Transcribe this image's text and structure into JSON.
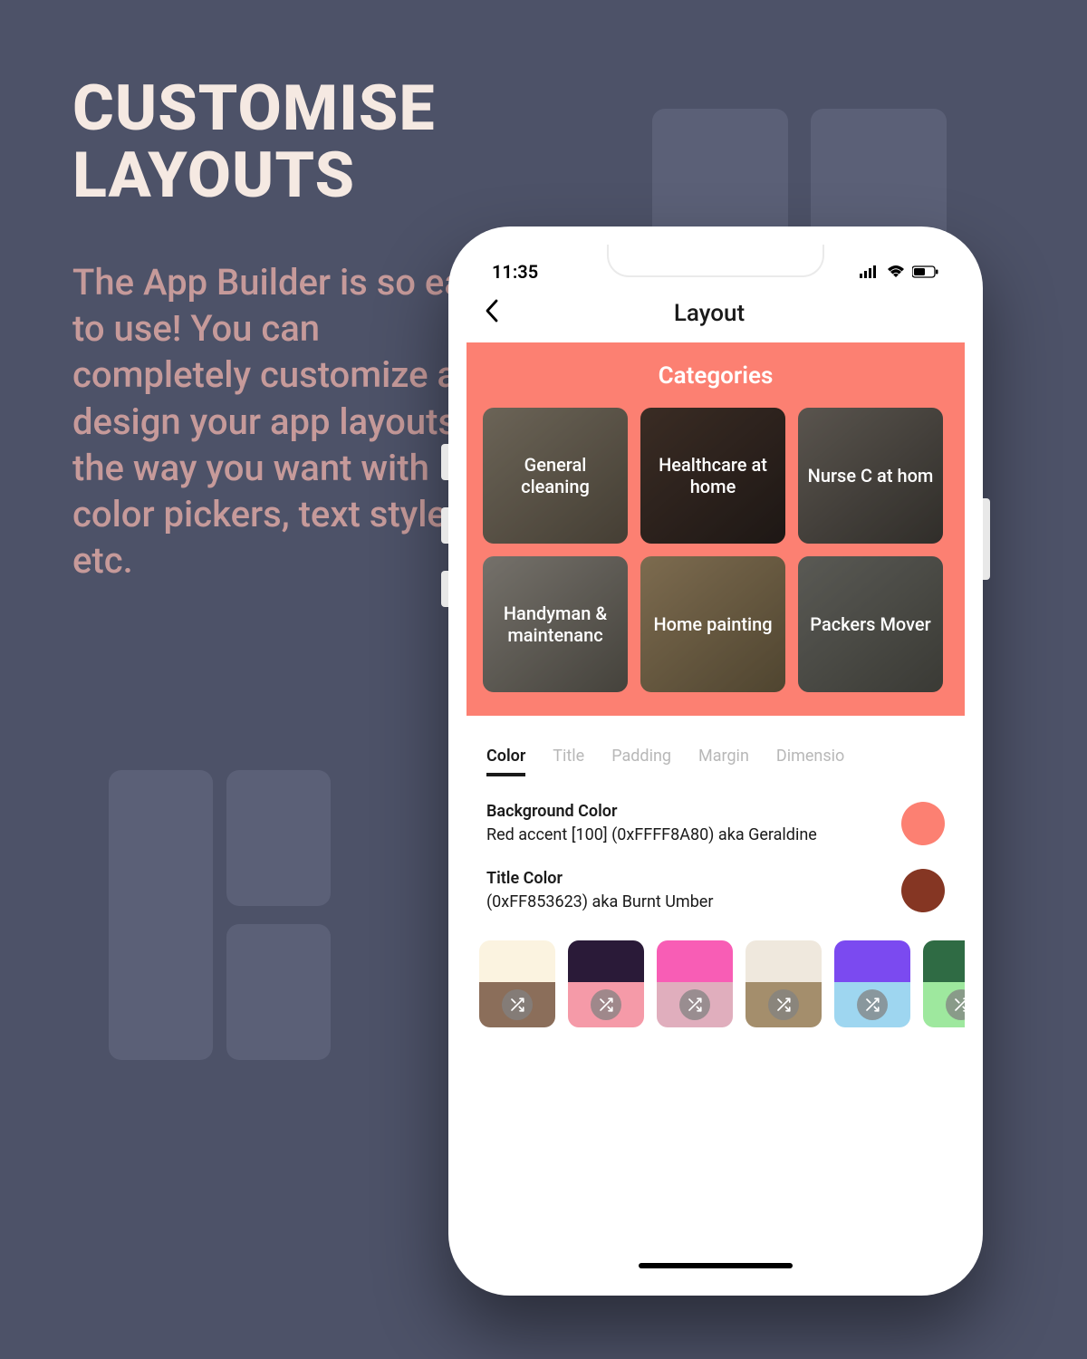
{
  "hero": {
    "title_line1": "CUSTOMISE",
    "title_line2": "LAYOUTS",
    "body": "The App Builder is so easy to use! You can completely customize and design your app layouts the way you want with color pickers, text styles, etc."
  },
  "status": {
    "time": "11:35"
  },
  "nav": {
    "title": "Layout"
  },
  "panel": {
    "title": "Categories",
    "categories": [
      {
        "label": "General cleaning"
      },
      {
        "label": "Healthcare at home"
      },
      {
        "label": "Nurse C at hom"
      },
      {
        "label": "Handyman & maintenanc"
      },
      {
        "label": "Home painting"
      },
      {
        "label": "Packers Mover"
      }
    ]
  },
  "tabs": {
    "active": 0,
    "items": [
      {
        "label": "Color"
      },
      {
        "label": "Title"
      },
      {
        "label": "Padding"
      },
      {
        "label": "Margin"
      },
      {
        "label": "Dimensio"
      }
    ]
  },
  "color_props": [
    {
      "name": "Background Color",
      "value": "Red accent [100] (0xFFFF8A80) aka Geraldine",
      "hex": "#fc8072"
    },
    {
      "name": "Title Color",
      "value": "(0xFF853623) aka Burnt Umber",
      "hex": "#853623"
    }
  ],
  "palettes": [
    {
      "top": "#fbf3e0",
      "bot": "#8b6e5a"
    },
    {
      "top": "#2a1a38",
      "bot": "#f59aa8"
    },
    {
      "top": "#f85db5",
      "bot": "#e0aebd"
    },
    {
      "top": "#efe8dd",
      "bot": "#a48e6c"
    },
    {
      "top": "#7b4af0",
      "bot": "#9ed6f0"
    },
    {
      "top": "#2f6b44",
      "bot": "#9ee89e"
    }
  ]
}
